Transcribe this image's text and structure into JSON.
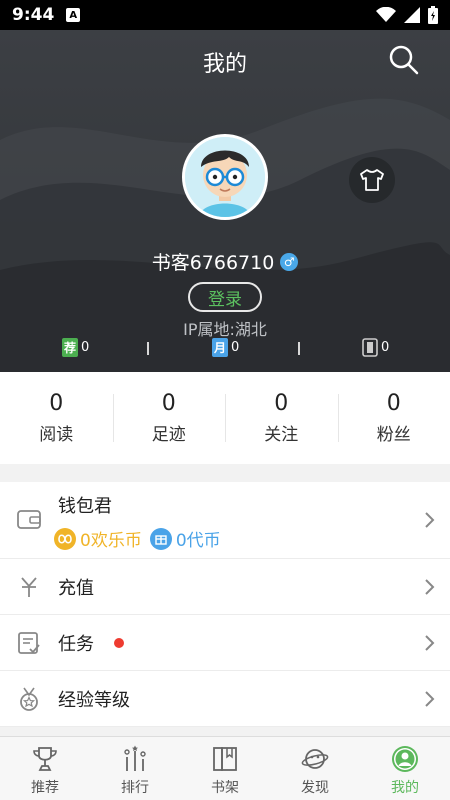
{
  "status_bar": {
    "time": "9:44",
    "badge": "A"
  },
  "header": {
    "title": "我的",
    "username": "书客6766710",
    "gender_symbol": "♂",
    "login_label": "登录",
    "ip_location": "IP属地:湖北",
    "tickets": [
      {
        "badge": "荐",
        "count": "0",
        "color": "#4caf50"
      },
      {
        "badge": "月",
        "count": "0",
        "color": "#4aa3e8"
      },
      {
        "badge": "",
        "count": "0",
        "color": "#cccccc"
      }
    ]
  },
  "stats": [
    {
      "value": "0",
      "label": "阅读"
    },
    {
      "value": "0",
      "label": "足迹"
    },
    {
      "value": "0",
      "label": "关注"
    },
    {
      "value": "0",
      "label": "粉丝"
    }
  ],
  "menu": {
    "wallet": {
      "label": "钱包君",
      "happy_coin": "0欢乐币",
      "voucher": "0代币",
      "happy_coin_color": "#f0b428",
      "voucher_color": "#4aa3e8"
    },
    "recharge": "充值",
    "tasks": "任务",
    "level": "经验等级"
  },
  "tabs": [
    {
      "label": "推荐",
      "icon": "trophy-icon"
    },
    {
      "label": "排行",
      "icon": "ranking-icon"
    },
    {
      "label": "书架",
      "icon": "bookshelf-icon"
    },
    {
      "label": "发现",
      "icon": "planet-icon"
    },
    {
      "label": "我的",
      "icon": "profile-icon",
      "active": true
    }
  ],
  "colors": {
    "accent": "#5cb85c",
    "header_bg": "#3c3f44",
    "task_dot": "#ee3b30"
  }
}
